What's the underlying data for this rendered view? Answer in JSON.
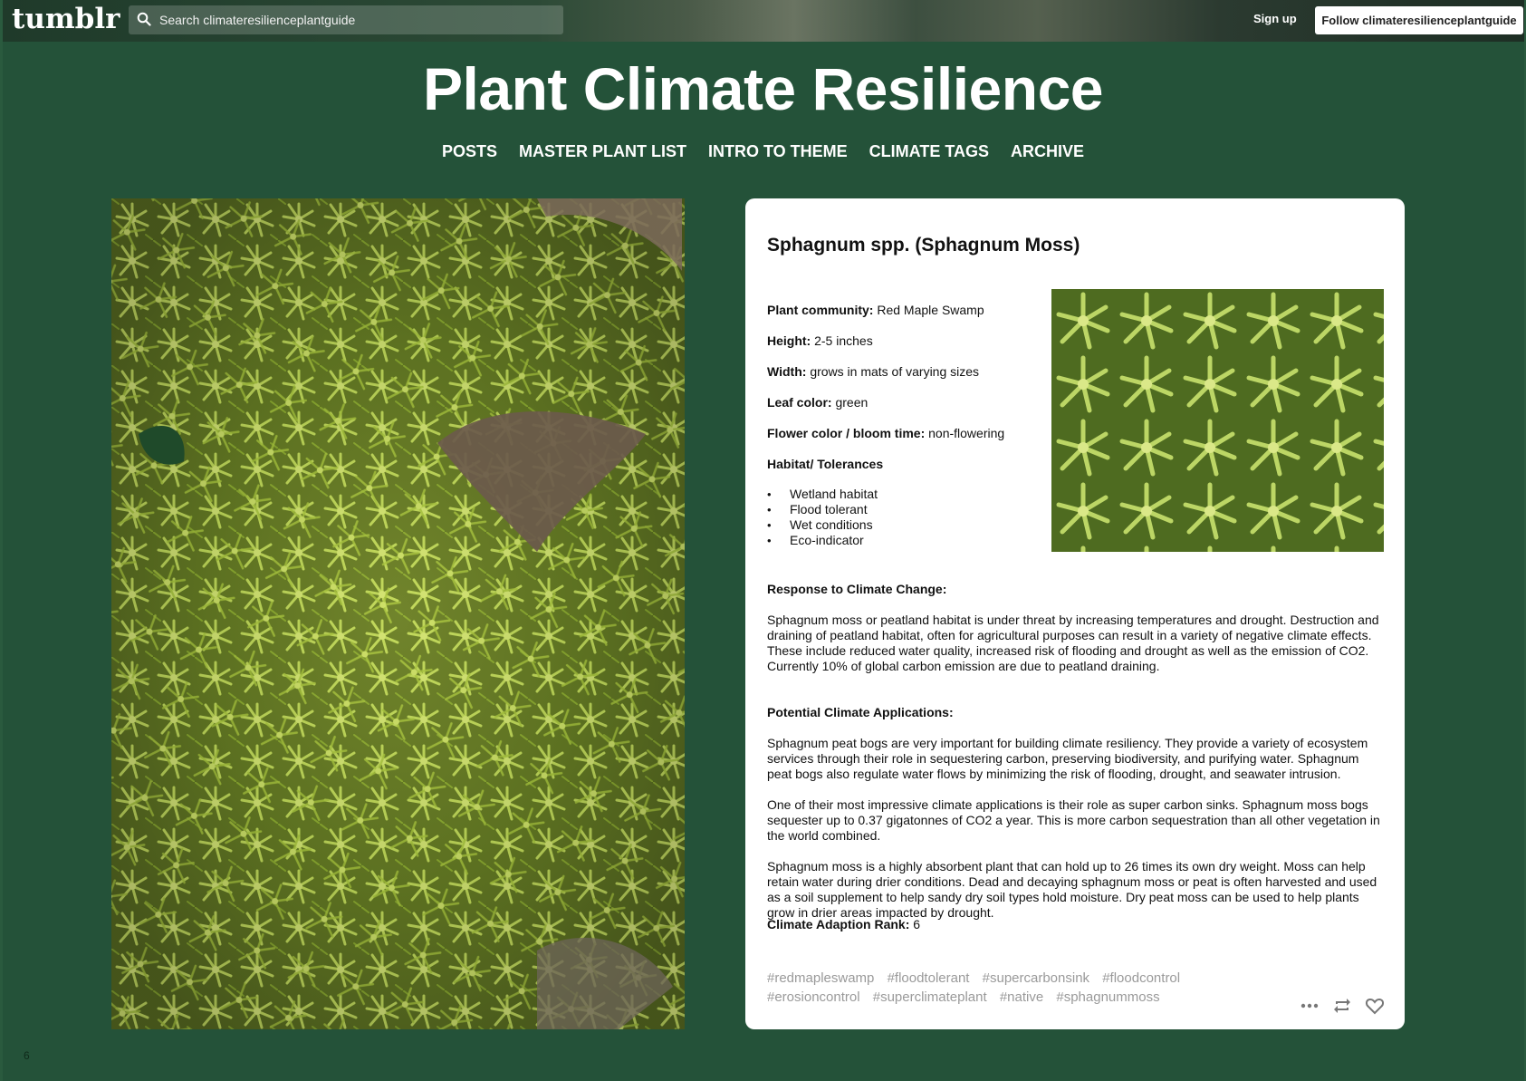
{
  "topbar": {
    "logo": "tumblr",
    "search_placeholder": "Search climateresilienceplantguide",
    "signup_label": "Sign up",
    "follow_label": "Follow climateresilienceplantguide"
  },
  "site": {
    "title": "Plant Climate Resilience",
    "nav": [
      "POSTS",
      "MASTER PLANT LIST",
      "INTRO TO THEME",
      "CLIMATE TAGS",
      "ARCHIVE"
    ]
  },
  "post": {
    "title": "Sphagnum spp. (Sphagnum Moss)",
    "facts": {
      "community_label": "Plant community:",
      "community_value": "Red Maple Swamp",
      "height_label": "Height:",
      "height_value": "2-5 inches",
      "width_label": "Width:",
      "width_value": "grows in mats of varying sizes",
      "leaf_label": "Leaf color:",
      "leaf_value": "green",
      "flower_label": "Flower color / bloom time:",
      "flower_value": "non-flowering",
      "habitat_label": "Habitat/ Tolerances"
    },
    "habitat": [
      "Wetland habitat",
      "Flood tolerant",
      "Wet conditions",
      "Eco-indicator"
    ],
    "response_heading": "Response to Climate Change:",
    "response_text": "Sphagnum moss or peatland habitat is under threat by increasing temperatures and drought. Destruction and draining of peatland habitat, often for agricultural purposes can result in a variety of negative climate effects. These include reduced water quality, increased risk of flooding and drought as well as the emission of CO2. Currently 10% of global carbon emission are due to peatland draining.",
    "applications_heading": "Potential Climate Applications:",
    "applications_p1": "Sphagnum peat bogs are very important for building climate resiliency. They provide a variety of ecosystem services through their role in sequestering carbon, preserving biodiversity, and purifying water. Sphagnum peat bogs also regulate water flows by minimizing the risk of flooding, drought, and seawater intrusion.",
    "applications_p2": "One of their most impressive climate applications is their role as super carbon sinks. Sphagnum moss bogs sequester up to 0.37 gigatonnes of CO2 a year. This is more carbon sequestration than all other vegetation in the world combined.",
    "applications_p3": "Sphagnum moss is a highly absorbent plant that can hold up to 26 times its own dry weight. Moss can help retain water during drier conditions. Dead and decaying sphagnum moss or peat is often harvested and used as a soil supplement to help sandy dry soil types hold moisture. Dry peat moss can be used to help plants grow in drier areas impacted by drought.",
    "rank_label": "Climate Adaption Rank:",
    "rank_value": "6",
    "tags": [
      "#redmapleswamp",
      "#floodtolerant",
      "#supercarbonsink",
      "#floodcontrol",
      "#erosioncontrol",
      "#superclimateplant",
      "#native",
      "#sphagnummoss"
    ]
  },
  "page_number": "6",
  "colors": {
    "background": "#245239",
    "card": "#ffffff",
    "tag": "#9a9a9a"
  }
}
